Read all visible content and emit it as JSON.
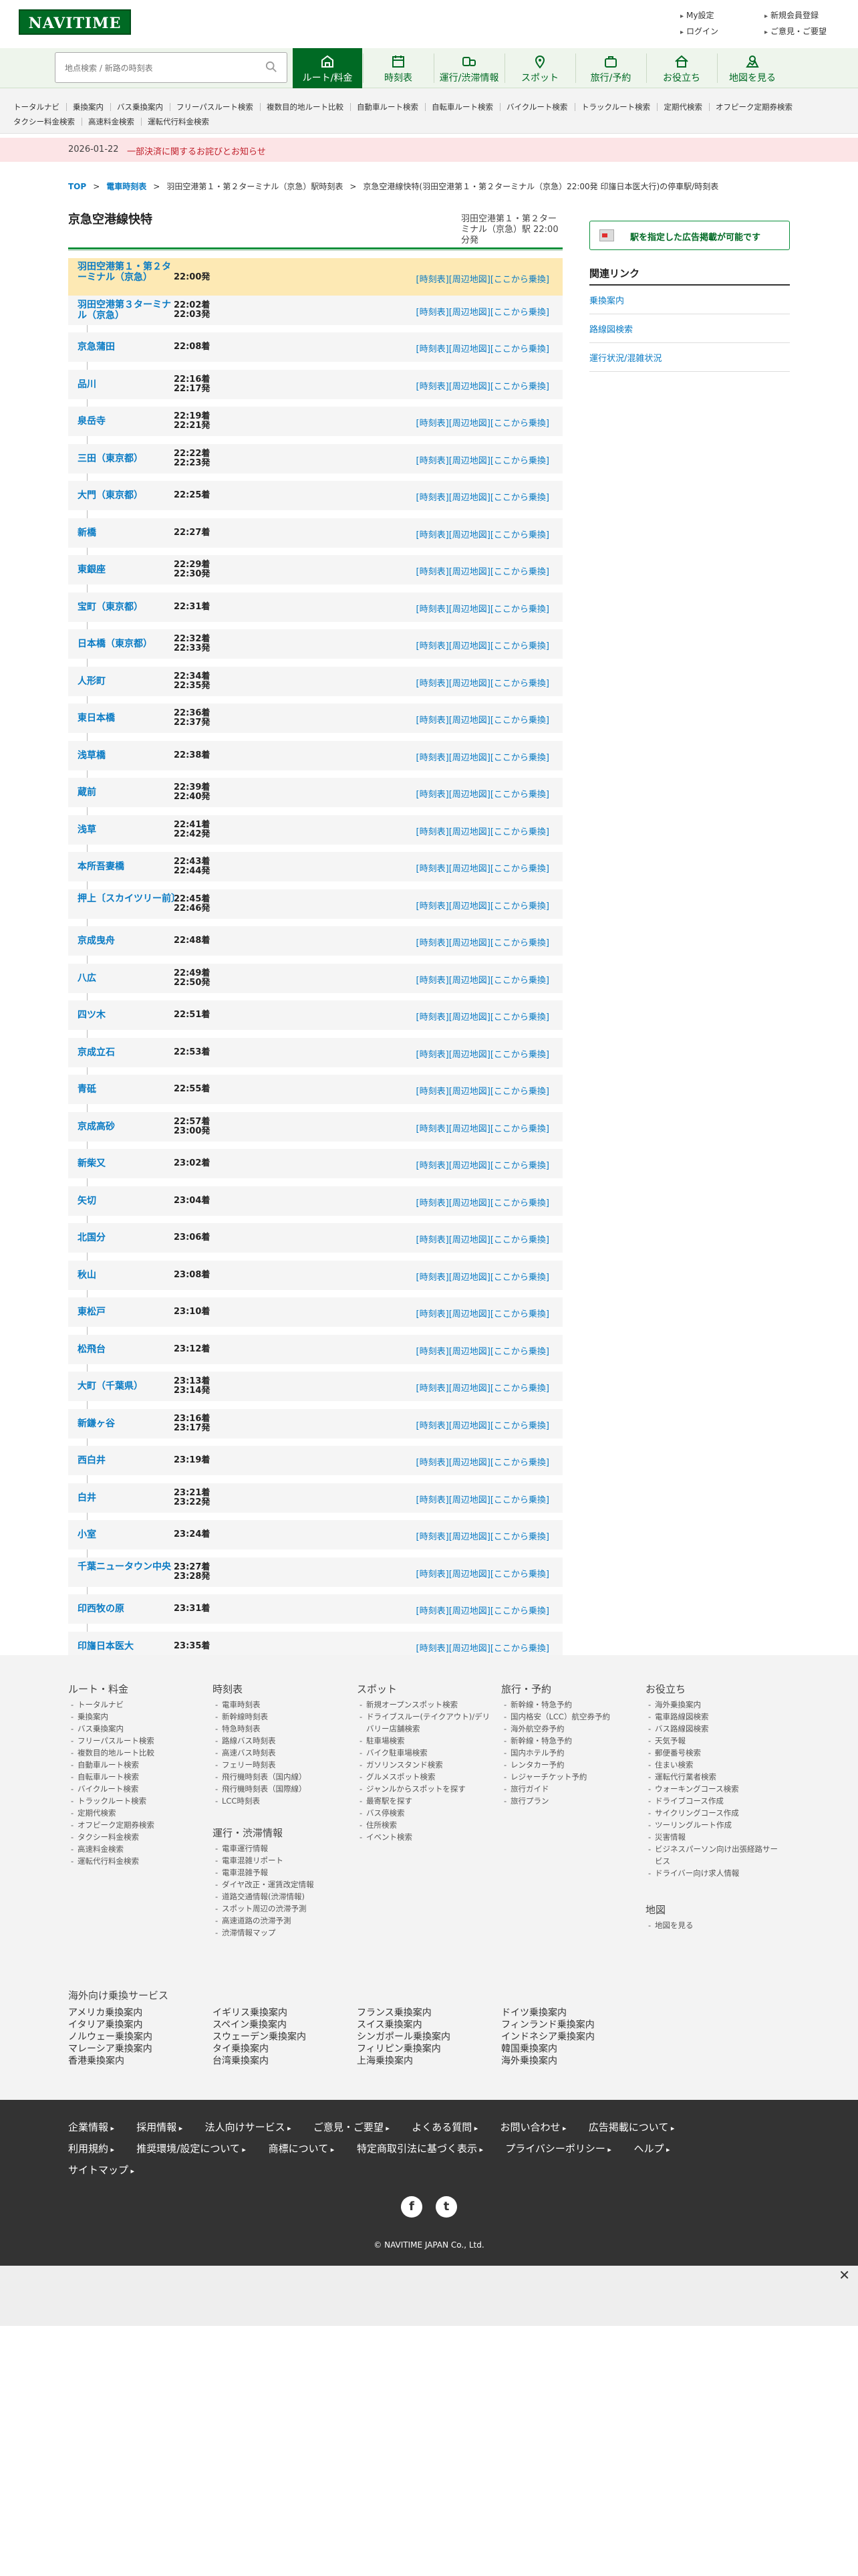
{
  "header": {
    "logo": "NAVITIME",
    "links": [
      "My設定",
      "新規会員登録",
      "ログイン",
      "ご意見・ご要望"
    ]
  },
  "search": {
    "placeholder": "地点検索 / 新路の時刻表"
  },
  "nav": [
    {
      "label": "ルート/料金",
      "icon": "route-icon",
      "active": true
    },
    {
      "label": "時刻表",
      "icon": "timetable-icon",
      "active": false
    },
    {
      "label": "運行/渋滞情報",
      "icon": "traffic-icon",
      "active": false
    },
    {
      "label": "スポット",
      "icon": "spot-icon",
      "active": false
    },
    {
      "label": "旅行/予約",
      "icon": "travel-icon",
      "active": false
    },
    {
      "label": "お役立ち",
      "icon": "useful-icon",
      "active": false
    },
    {
      "label": "地図を見る",
      "icon": "map-icon",
      "active": false
    }
  ],
  "subnav": [
    "トータルナビ",
    "乗換案内",
    "バス乗換案内",
    "フリーパスルート検索",
    "複数目的地ルート比較",
    "自動車ルート検索",
    "自転車ルート検索",
    "バイクルート検索",
    "トラックルート検索",
    "定期代検索",
    "オフピーク定期券検索",
    "タクシー料金検索",
    "高速料金検索",
    "運転代行料金検索"
  ],
  "notice": {
    "date": "2026-01-22",
    "message": "一部決済に関するお詫びとお知らせ"
  },
  "breadcrumb": {
    "items": [
      "TOP",
      "電車時刻表",
      "羽田空港第１・第２ターミナル（京急）駅時刻表",
      "京急空港線快特(羽田空港第１・第２ターミナル（京急）22:00発 印旛日本医大行)の停車駅/時刻表"
    ]
  },
  "main": {
    "title": "京急空港線快特",
    "station_info": "羽田空港第１・第２ターミナル（京急）駅 22:00分発",
    "link_labels": {
      "timetable": "[時刻表]",
      "map": "[周辺地図]",
      "board": "[ここから乗換]"
    },
    "stops": [
      {
        "name": "羽田空港第１・第２ターミナル（京急）",
        "times": [
          "22:00発"
        ]
      },
      {
        "name": "羽田空港第３ターミナル（京急）",
        "times": [
          "22:02着",
          "22:03発"
        ]
      },
      {
        "name": "京急蒲田",
        "times": [
          "22:08着"
        ]
      },
      {
        "name": "品川",
        "times": [
          "22:16着",
          "22:17発"
        ]
      },
      {
        "name": "泉岳寺",
        "times": [
          "22:19着",
          "22:21発"
        ]
      },
      {
        "name": "三田（東京都）",
        "times": [
          "22:22着",
          "22:23発"
        ]
      },
      {
        "name": "大門（東京都）",
        "times": [
          "22:25着"
        ]
      },
      {
        "name": "新橋",
        "times": [
          "22:27着"
        ]
      },
      {
        "name": "東銀座",
        "times": [
          "22:29着",
          "22:30発"
        ]
      },
      {
        "name": "宝町（東京都）",
        "times": [
          "22:31着"
        ]
      },
      {
        "name": "日本橋（東京都）",
        "times": [
          "22:32着",
          "22:33発"
        ]
      },
      {
        "name": "人形町",
        "times": [
          "22:34着",
          "22:35発"
        ]
      },
      {
        "name": "東日本橋",
        "times": [
          "22:36着",
          "22:37発"
        ]
      },
      {
        "name": "浅草橋",
        "times": [
          "22:38着"
        ]
      },
      {
        "name": "蔵前",
        "times": [
          "22:39着",
          "22:40発"
        ]
      },
      {
        "name": "浅草",
        "times": [
          "22:41着",
          "22:42発"
        ]
      },
      {
        "name": "本所吾妻橋",
        "times": [
          "22:43着",
          "22:44発"
        ]
      },
      {
        "name": "押上〔スカイツリー前〕",
        "times": [
          "22:45着",
          "22:46発"
        ]
      },
      {
        "name": "京成曳舟",
        "times": [
          "22:48着"
        ]
      },
      {
        "name": "八広",
        "times": [
          "22:49着",
          "22:50発"
        ]
      },
      {
        "name": "四ツ木",
        "times": [
          "22:51着"
        ]
      },
      {
        "name": "京成立石",
        "times": [
          "22:53着"
        ]
      },
      {
        "name": "青砥",
        "times": [
          "22:55着"
        ]
      },
      {
        "name": "京成高砂",
        "times": [
          "22:57着",
          "23:00発"
        ]
      },
      {
        "name": "新柴又",
        "times": [
          "23:02着"
        ]
      },
      {
        "name": "矢切",
        "times": [
          "23:04着"
        ]
      },
      {
        "name": "北国分",
        "times": [
          "23:06着"
        ]
      },
      {
        "name": "秋山",
        "times": [
          "23:08着"
        ]
      },
      {
        "name": "東松戸",
        "times": [
          "23:10着"
        ]
      },
      {
        "name": "松飛台",
        "times": [
          "23:12着"
        ]
      },
      {
        "name": "大町（千葉県）",
        "times": [
          "23:13着",
          "23:14発"
        ]
      },
      {
        "name": "新鎌ヶ谷",
        "times": [
          "23:16着",
          "23:17発"
        ]
      },
      {
        "name": "西白井",
        "times": [
          "23:19着"
        ]
      },
      {
        "name": "白井",
        "times": [
          "23:21着",
          "23:22発"
        ]
      },
      {
        "name": "小室",
        "times": [
          "23:24着"
        ]
      },
      {
        "name": "千葉ニュータウン中央",
        "times": [
          "23:27着",
          "23:28発"
        ]
      },
      {
        "name": "印西牧の原",
        "times": [
          "23:31着"
        ]
      },
      {
        "name": "印旛日本医大",
        "times": [
          "23:35着"
        ]
      }
    ]
  },
  "sidebar": {
    "ad_button": "駅を指定した広告掲載が可能です",
    "related_heading": "関連リンク",
    "related_links": [
      "乗換案内",
      "路線図検索",
      "運行状況/混雑状況"
    ]
  },
  "sitemap": {
    "columns": [
      {
        "heading": "ルート・料金",
        "items": [
          "トータルナビ",
          "乗換案内",
          "バス乗換案内",
          "フリーパスルート検索",
          "複数目的地ルート比較",
          "自動車ルート検索",
          "自転車ルート検索",
          "バイクルート検索",
          "トラックルート検索",
          "定期代検索",
          "オフピーク定期券検索",
          "タクシー料金検索",
          "高速料金検索",
          "運転代行料金検索"
        ]
      },
      {
        "heading": "時刻表",
        "items": [
          "電車時刻表",
          "新幹線時刻表",
          "特急時刻表",
          "路線バス時刻表",
          "高速バス時刻表",
          "フェリー時刻表",
          "飛行機時刻表（国内線）",
          "飛行機時刻表（国際線）",
          "LCC時刻表"
        ]
      },
      {
        "heading": "運行・渋滞情報",
        "items": [
          "電車運行情報",
          "電車混雑リポート",
          "電車混雑予報",
          "ダイヤ改正・運賃改定情報",
          "道路交通情報(渋滞情報)",
          "スポット周辺の渋滞予測",
          "高速道路の渋滞予測",
          "渋滞情報マップ"
        ]
      },
      {
        "heading": "スポット",
        "items": [
          "新規オープンスポット検索",
          "ドライブスルー(テイクアウト)/デリバリー店舗検索",
          "駐車場検索",
          "バイク駐車場検索",
          "ガソリンスタンド検索",
          "グルメスポット検索",
          "ジャンルからスポットを探す",
          "最寄駅を探す",
          "バス停検索",
          "住所検索",
          "イベント検索"
        ]
      },
      {
        "heading": "旅行・予約",
        "items": [
          "新幹線・特急予約",
          "国内格安（LCC）航空券予約",
          "海外航空券予約",
          "新幹線・特急予約",
          "国内ホテル予約",
          "レンタカー予約",
          "レジャーチケット予約",
          "旅行ガイド",
          "旅行プラン"
        ]
      },
      {
        "heading": "お役立ち",
        "items": [
          "海外乗換案内",
          "電車路線図検索",
          "バス路線図検索",
          "天気予報",
          "郵便番号検索",
          "住まい検索",
          "運転代行業者検索",
          "ウォーキングコース検索",
          "ドライブコース作成",
          "サイクリングコース作成",
          "ツーリングルート作成",
          "災害情報",
          "ビジネスパーソン向け出張経路サービス",
          "ドライバー向け求人情報"
        ]
      },
      {
        "heading": "地図",
        "items": [
          "地図を見る"
        ]
      }
    ],
    "overseas_heading": "海外向け乗換サービス",
    "overseas": [
      "アメリカ乗換案内",
      "イギリス乗換案内",
      "フランス乗換案内",
      "ドイツ乗換案内",
      "イタリア乗換案内",
      "スペイン乗換案内",
      "スイス乗換案内",
      "フィンランド乗換案内",
      "ノルウェー乗換案内",
      "スウェーデン乗換案内",
      "シンガポール乗換案内",
      "インドネシア乗換案内",
      "マレーシア乗換案内",
      "タイ乗換案内",
      "フィリピン乗換案内",
      "韓国乗換案内",
      "香港乗換案内",
      "台湾乗換案内",
      "上海乗換案内",
      "海外乗換案内"
    ]
  },
  "footer": {
    "links_row1": [
      "企業情報",
      "採用情報",
      "法人向けサービス",
      "ご意見・ご要望",
      "よくある質問",
      "お問い合わせ",
      "広告掲載について"
    ],
    "links_row2": [
      "利用規約",
      "推奨環境/設定について",
      "商標について",
      "特定商取引法に基づく表示",
      "プライバシーポリシー",
      "ヘルプ"
    ],
    "links_row3": [
      "サイトマップ"
    ],
    "copyright": "© NAVITIME JAPAN Co., Ltd."
  },
  "ad_close": "✕"
}
